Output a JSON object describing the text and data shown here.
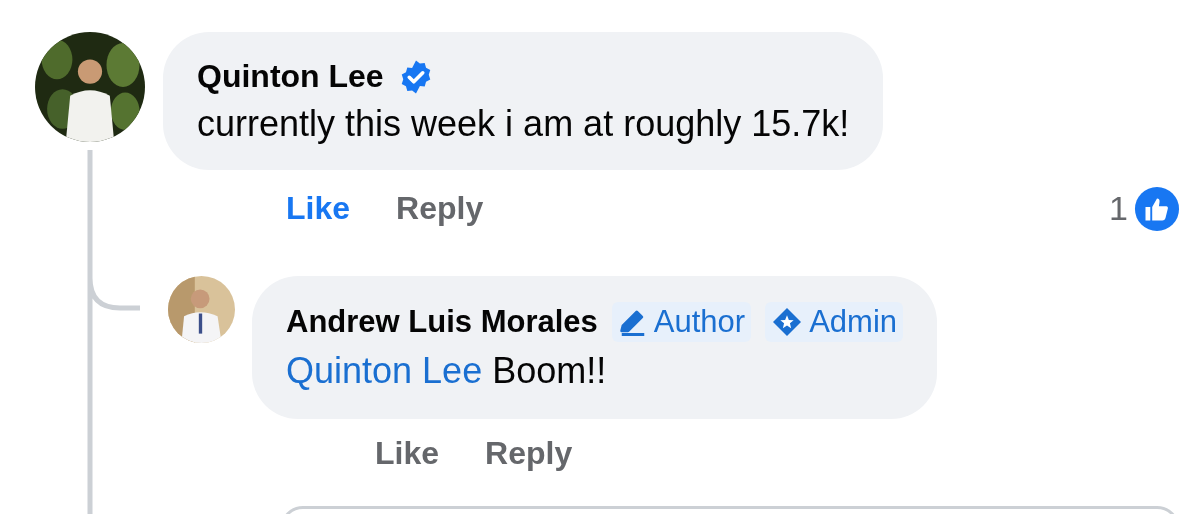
{
  "comment": {
    "author": "Quinton Lee",
    "verified": true,
    "text": "currently this week i am at roughly 15.7k!",
    "actions": [
      {
        "label": "Like",
        "selected": true
      },
      {
        "label": "Reply",
        "selected": false
      }
    ],
    "reaction_count": "1"
  },
  "reply": {
    "author": "Andrew Luis Morales",
    "badges": [
      {
        "kind": "author",
        "label": "Author"
      },
      {
        "kind": "admin",
        "label": "Admin"
      }
    ],
    "mention": "Quinton Lee",
    "text": "Boom!!",
    "actions": [
      {
        "label": "Like",
        "selected": false
      },
      {
        "label": "Reply",
        "selected": false
      }
    ]
  }
}
